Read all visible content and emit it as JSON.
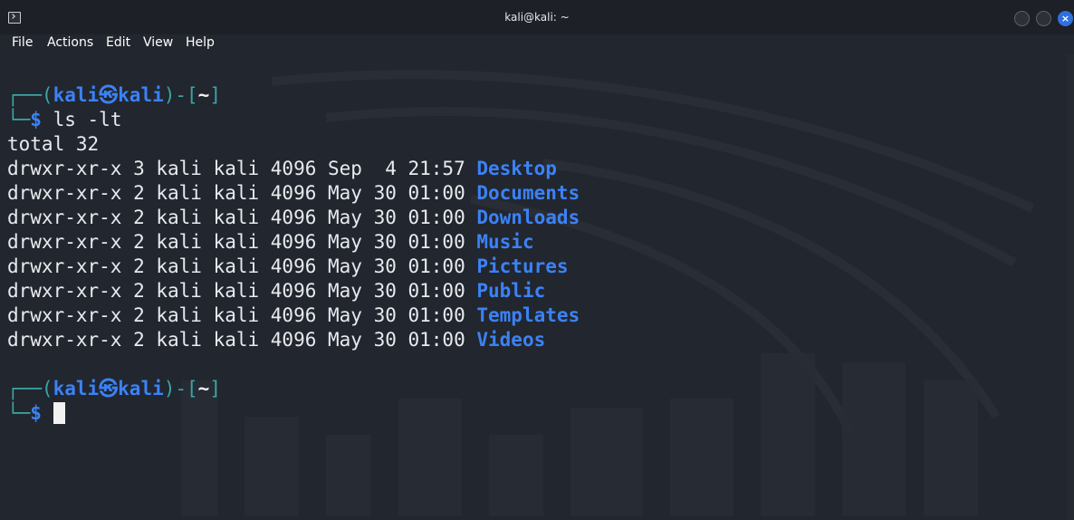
{
  "window": {
    "title": "kali@kali: ~"
  },
  "menu": {
    "items": [
      "File",
      "Actions",
      "Edit",
      "View",
      "Help"
    ]
  },
  "prompt": {
    "box_top": "┌──(",
    "user": "kali",
    "at": "㉿",
    "host": "kali",
    "mid": ")-[",
    "cwd": "~",
    "close": "]",
    "box_bottom": "└─",
    "symbol": "$"
  },
  "session": {
    "command": "ls -lt",
    "total": "total 32",
    "entries": [
      {
        "meta": "drwxr-xr-x 3 kali kali 4096 Sep  4 21:57 ",
        "name": "Desktop"
      },
      {
        "meta": "drwxr-xr-x 2 kali kali 4096 May 30 01:00 ",
        "name": "Documents"
      },
      {
        "meta": "drwxr-xr-x 2 kali kali 4096 May 30 01:00 ",
        "name": "Downloads"
      },
      {
        "meta": "drwxr-xr-x 2 kali kali 4096 May 30 01:00 ",
        "name": "Music"
      },
      {
        "meta": "drwxr-xr-x 2 kali kali 4096 May 30 01:00 ",
        "name": "Pictures"
      },
      {
        "meta": "drwxr-xr-x 2 kali kali 4096 May 30 01:00 ",
        "name": "Public"
      },
      {
        "meta": "drwxr-xr-x 2 kali kali 4096 May 30 01:00 ",
        "name": "Templates"
      },
      {
        "meta": "drwxr-xr-x 2 kali kali 4096 May 30 01:00 ",
        "name": "Videos"
      }
    ]
  },
  "icons": {
    "app": "terminal-icon",
    "minimize": "minimize-icon",
    "maximize": "maximize-icon",
    "close": "close-icon"
  },
  "colors": {
    "background": "#22262e",
    "prompt_blue": "#3b82f6",
    "box_teal": "#3aa6a6",
    "text": "#e8eaee",
    "close_button": "#2f6fdf"
  }
}
